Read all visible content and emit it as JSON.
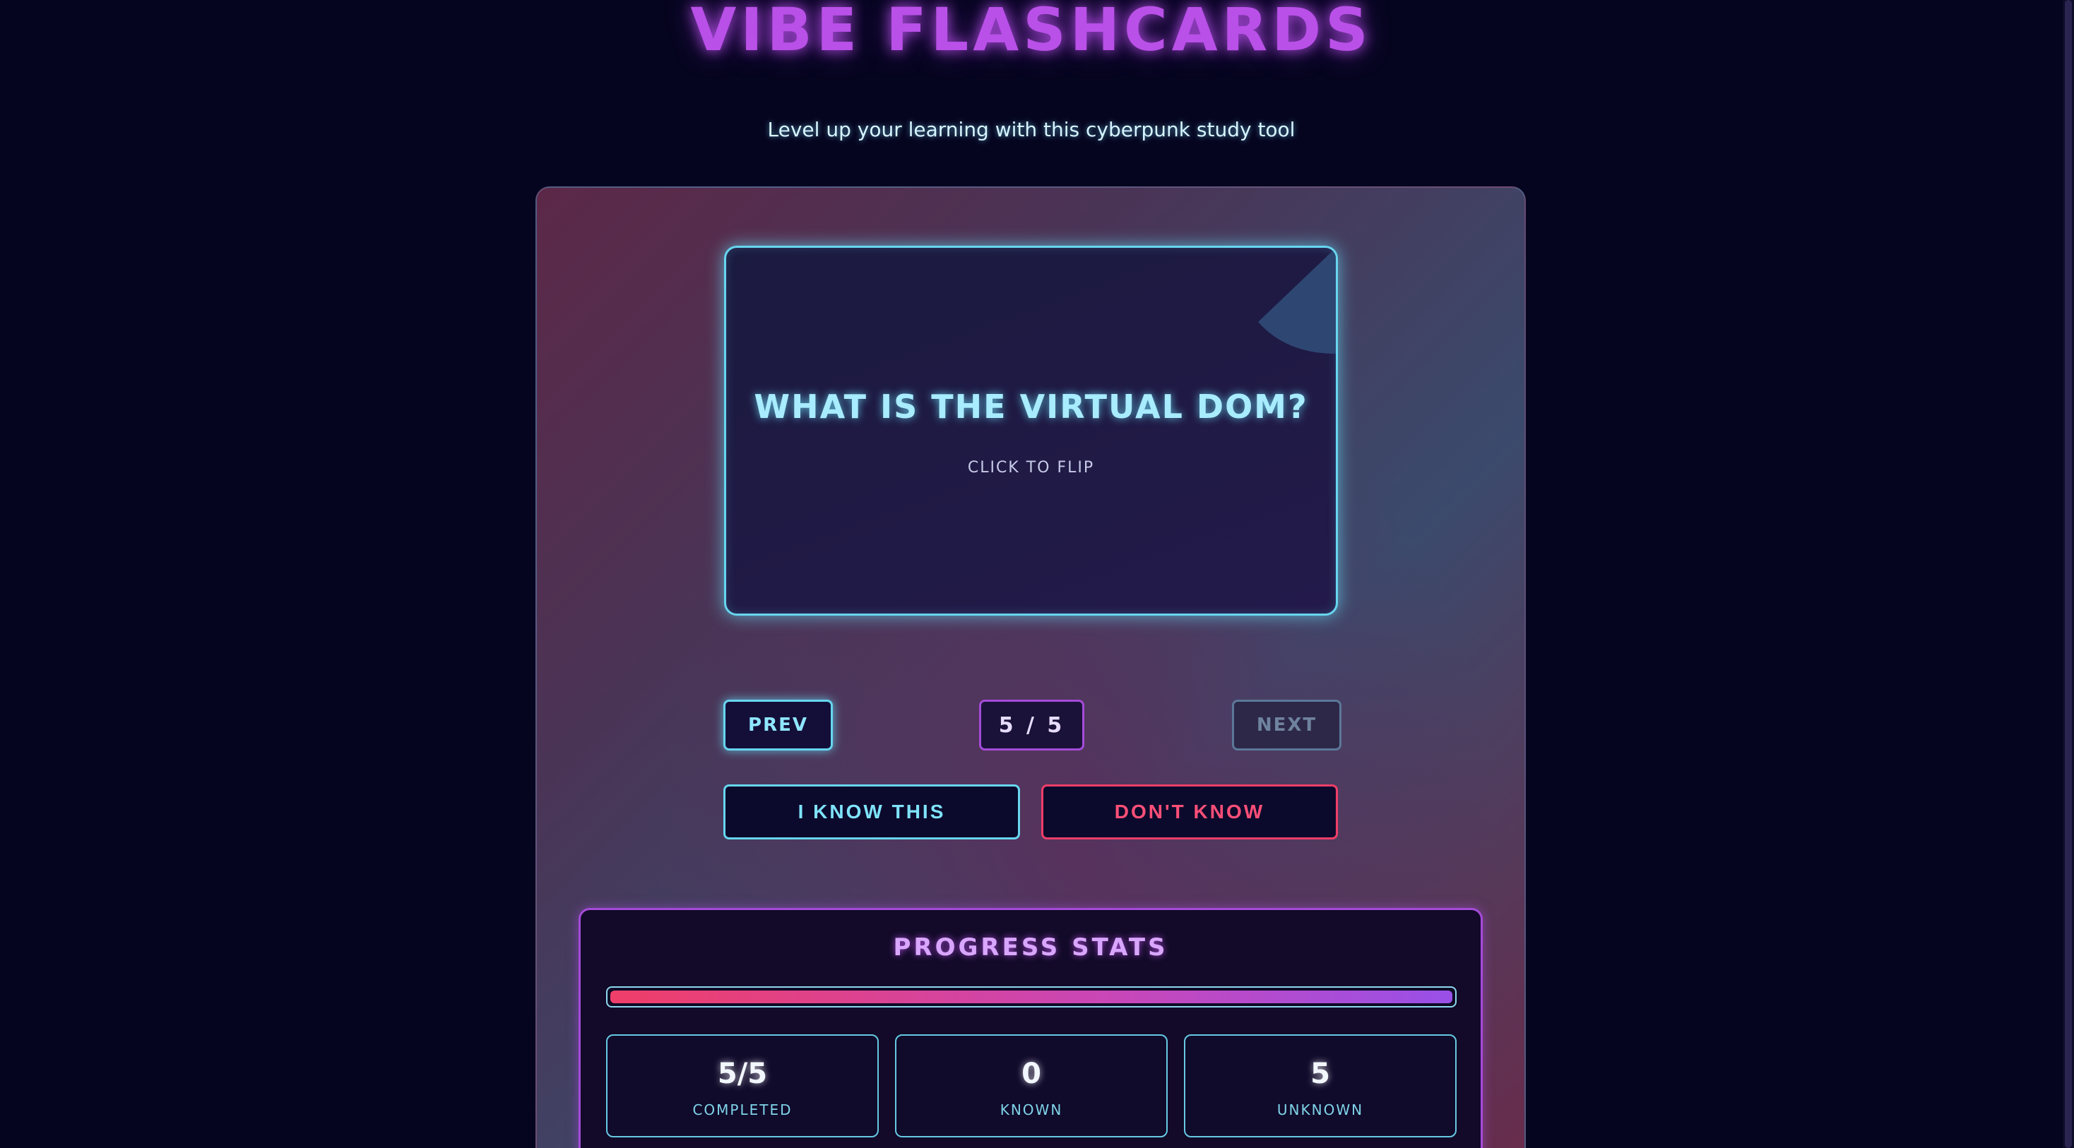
{
  "header": {
    "title": "VIBE FLASHCARDS",
    "subtitle": "Level up your learning with this cyberpunk study tool"
  },
  "card": {
    "question": "WHAT IS THE VIRTUAL DOM?",
    "hint": "CLICK TO FLIP"
  },
  "navigation": {
    "prev_label": "PREV",
    "counter": "5 / 5",
    "next_label": "NEXT"
  },
  "actions": {
    "know_label": "I KNOW THIS",
    "dont_know_label": "DON'T KNOW"
  },
  "stats": {
    "title": "PROGRESS STATS",
    "progress_fraction": 1.0,
    "completed": {
      "value": "5/5",
      "label": "COMPLETED"
    },
    "known": {
      "value": "0",
      "label": "KNOWN"
    },
    "unknown": {
      "value": "5",
      "label": "UNKNOWN"
    }
  },
  "colors": {
    "background": "#06051f",
    "accent_purple": "#b950e8",
    "accent_cyan": "#67d6ef",
    "accent_red": "#ef3e69"
  }
}
